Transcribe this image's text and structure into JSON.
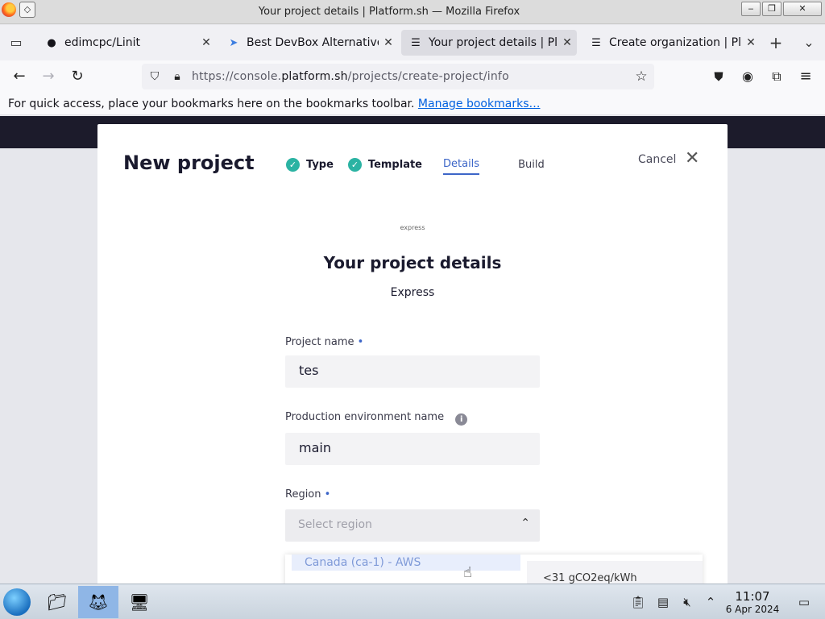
{
  "window": {
    "title": "Your project details | Platform.sh — Mozilla Firefox",
    "pin_icon": "diamond-pin-icon",
    "minimize_label": "‒",
    "maximize_label": "❐",
    "close_label": "✕"
  },
  "tabs": [
    {
      "label": "edimcpc/Linit",
      "icon": "github-icon",
      "active": false
    },
    {
      "label": "Best DevBox Alternatives",
      "icon": "devbox-icon",
      "active": false
    },
    {
      "label": "Your project details | Plat",
      "icon": "page-icon",
      "active": true
    },
    {
      "label": "Create organization | Pla",
      "icon": "page-icon",
      "active": false
    }
  ],
  "tab_close_glyph": "✕",
  "new_tab_glyph": "+",
  "tab_list_glyph": "⌄",
  "nav": {
    "url_prefix": "https://console.",
    "url_domain": "platform.sh",
    "url_suffix": "/projects/create-project/info"
  },
  "bookmarks": {
    "text": "For quick access, place your bookmarks here on the bookmarks toolbar.",
    "link": "Manage bookmarks…"
  },
  "modal": {
    "heading": "New project",
    "steps": [
      {
        "label": "Type",
        "state": "done"
      },
      {
        "label": "Template",
        "state": "done"
      },
      {
        "label": "Details",
        "state": "current"
      },
      {
        "label": "Build",
        "state": "todo"
      }
    ],
    "cancel": "Cancel",
    "logo_text": "express",
    "title": "Your project details",
    "subtitle": "Express",
    "project_name_label": "Project name",
    "project_name_value": "tes",
    "env_label": "Production environment name",
    "env_value": "main",
    "region_label": "Region",
    "region_placeholder": "Select region",
    "required_mark": "•",
    "dropdown_item": "Canada (ca-1) - AWS",
    "dropdown_right": "<31 gCO2eq/kWh"
  },
  "taskbar": {
    "time": "11:07",
    "date": "6 Apr 2024"
  },
  "colors": {
    "accent": "#3d66c8",
    "check_green": "#2bb3a3",
    "dark_band": "#1c1b2b"
  }
}
